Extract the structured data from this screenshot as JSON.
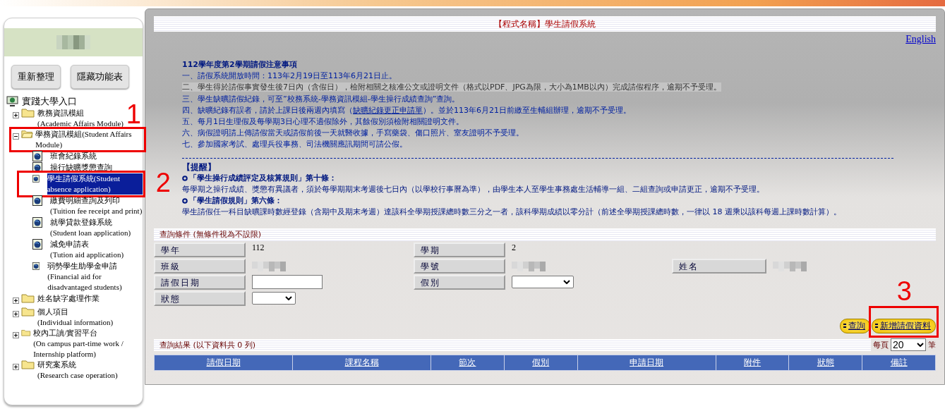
{
  "sidebar": {
    "buttons": [
      "重新整理",
      "隱藏功能表"
    ],
    "root": "實踐大學入口",
    "tree": [
      {
        "kind": "folder",
        "label": "教務資訊模組",
        "sublabel": "(Academic Affairs Module)",
        "expanded": false
      },
      {
        "kind": "folder",
        "label": "學務資訊模組(Student Affairs Module)",
        "expanded": true,
        "annotation": "1",
        "children": [
          {
            "kind": "page",
            "label": "班會紀錄系統",
            "selected": false
          },
          {
            "kind": "page",
            "label": "操行缺曠獎懲查詢",
            "selected": false
          },
          {
            "kind": "page",
            "label": "學生請假系統(Student absence application)",
            "selected": true,
            "annotation": "2"
          },
          {
            "kind": "page",
            "label": "繳費明細查詢及列印",
            "sublabel": "(Tuition fee receipt and print)",
            "selected": false
          },
          {
            "kind": "page",
            "label": "就學貸款登錄系統",
            "sublabel": "(Student loan application)",
            "selected": false
          },
          {
            "kind": "page",
            "label": "減免申請表",
            "sublabel": "(Tution aid application)",
            "selected": false
          },
          {
            "kind": "page",
            "label": "弱勢學生助學金申請",
            "sublabel": "(Financial aid for disadvantaged students)",
            "selected": false
          }
        ]
      },
      {
        "kind": "folder",
        "label": "姓名缺字處理作業",
        "expanded": false
      },
      {
        "kind": "folder",
        "label": "個人項目",
        "sublabel": "(Individual information)",
        "expanded": false
      },
      {
        "kind": "folder",
        "label": "校內工讀/實習平台",
        "sublabel": "(On campus part-time work / Internship platform)",
        "expanded": false
      },
      {
        "kind": "folder",
        "label": "研究案系統",
        "sublabel": "(Research case operation)",
        "expanded": false
      }
    ]
  },
  "header": {
    "title": "【程式名稱】學生請假系統",
    "language_link": "English"
  },
  "notice": {
    "heading": "112學年度第2學期請假注意事項",
    "items": [
      {
        "text": "一、請假系統開放時間：113年2月19日至113年6月21日止。",
        "highlighted": false
      },
      {
        "text": "二、學生得於請假事實發生後7日內（含假日），檢附相關之核准公文或證明文件（格式以PDF、JPG為限，大小為1MB以內）完成請假程序，逾期不予受理。",
        "highlighted": true
      },
      {
        "text": "三、學生缺曠請假紀錄，可至”校務系統-學務資訊模組-學生操行成績查詢”查詢。",
        "highlighted": false
      },
      {
        "text": "四、缺曠紀錄有誤者，請於上課日後兩週內填寫（",
        "link": "缺曠紀錄更正申請單",
        "after": "）。並於113年6月21日前繳至生輔組辦理，逾期不予受理。",
        "highlighted": false
      },
      {
        "text": "五、每月1日生理假及每學期3日心理不適假除外，其餘假別須檢附相關證明文件。",
        "highlighted": false
      },
      {
        "text": "六、病假證明請上傳請假當天或請假前後一天就醫收據，手寫藥袋、傷口照片、室友證明不予受理。",
        "highlighted": false
      },
      {
        "text": "七、參加國家考試、處理兵役事務、司法機關應訊期間可請公假。",
        "highlighted": false
      }
    ]
  },
  "reminder": {
    "heading": "【提醒】",
    "rules": [
      {
        "title": "「學生操行成績評定及核算規則」第十條：",
        "text": "每學期之操行成績、獎懲有異議者，須於每學期期末考週後七日內（以學校行事曆為準），由學生本人至學生事務處生活輔導一組、二組查詢或申請更正，逾期不予受理。"
      },
      {
        "title": "「學生請假規則」第六條：",
        "text": "學生請假任一科目缺曠課時數經登錄（含期中及期末考週）達該科全學期授課總時數三分之一者，該科學期成績以零分計（前述全學期授課總時數，一律以 18 週乘以該科每週上課時數計算）。"
      }
    ]
  },
  "query": {
    "title": "查詢條件 (無條件視為不設限)",
    "rows": [
      [
        {
          "label": "學年",
          "kind": "text",
          "value": "112"
        },
        {
          "label": "學期",
          "kind": "text",
          "value": "2"
        }
      ],
      [
        {
          "label": "班級",
          "kind": "blurred"
        },
        {
          "label": "學號",
          "kind": "blurred"
        },
        {
          "label": "姓名",
          "kind": "blurred"
        }
      ],
      [
        {
          "label": "請假日期",
          "kind": "input"
        },
        {
          "label": "假別",
          "kind": "select"
        }
      ],
      [
        {
          "label": "狀態",
          "kind": "select"
        }
      ]
    ],
    "buttons": [
      {
        "label": "查詢"
      },
      {
        "label": "新增請假資料",
        "annotation": "3"
      }
    ]
  },
  "results": {
    "title": "查詢結果 (以下資料共 0 列)",
    "per_page_label": "每頁",
    "per_page": "20",
    "unit": "筆",
    "columns": [
      "請假日期",
      "課程名稱",
      "節次",
      "假別",
      "申請日期",
      "附件",
      "狀態",
      "備註"
    ]
  }
}
